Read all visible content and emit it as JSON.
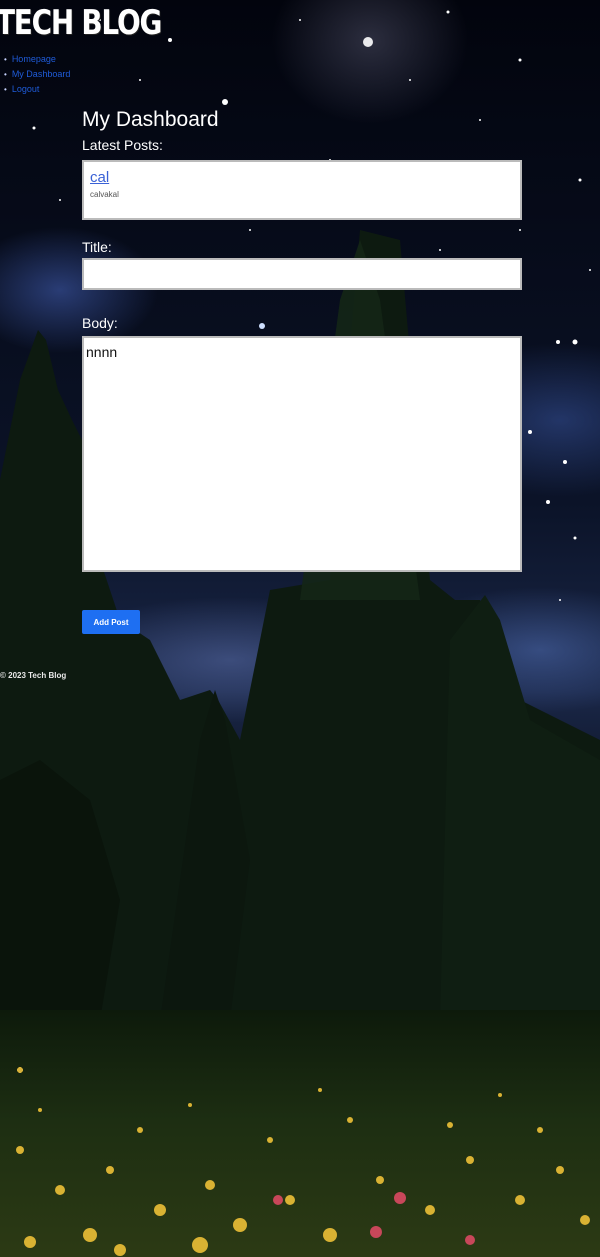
{
  "header": {
    "title": "TECH BLOG",
    "nav": [
      "Homepage",
      "My Dashboard",
      "Logout"
    ]
  },
  "dashboard": {
    "title": "My Dashboard",
    "latest_label": "Latest Posts:",
    "posts": [
      {
        "title": "cal",
        "body": "calvakal"
      }
    ],
    "title_label": "Title:",
    "title_value": "",
    "body_label": "Body:",
    "body_value": "nnnn",
    "add_button": "Add Post"
  },
  "footer": {
    "text": "© 2023 Tech Blog"
  },
  "colors": {
    "nav_link": "#1f5bd8",
    "button": "#1e6ff2",
    "post_title": "#3a61d6"
  }
}
